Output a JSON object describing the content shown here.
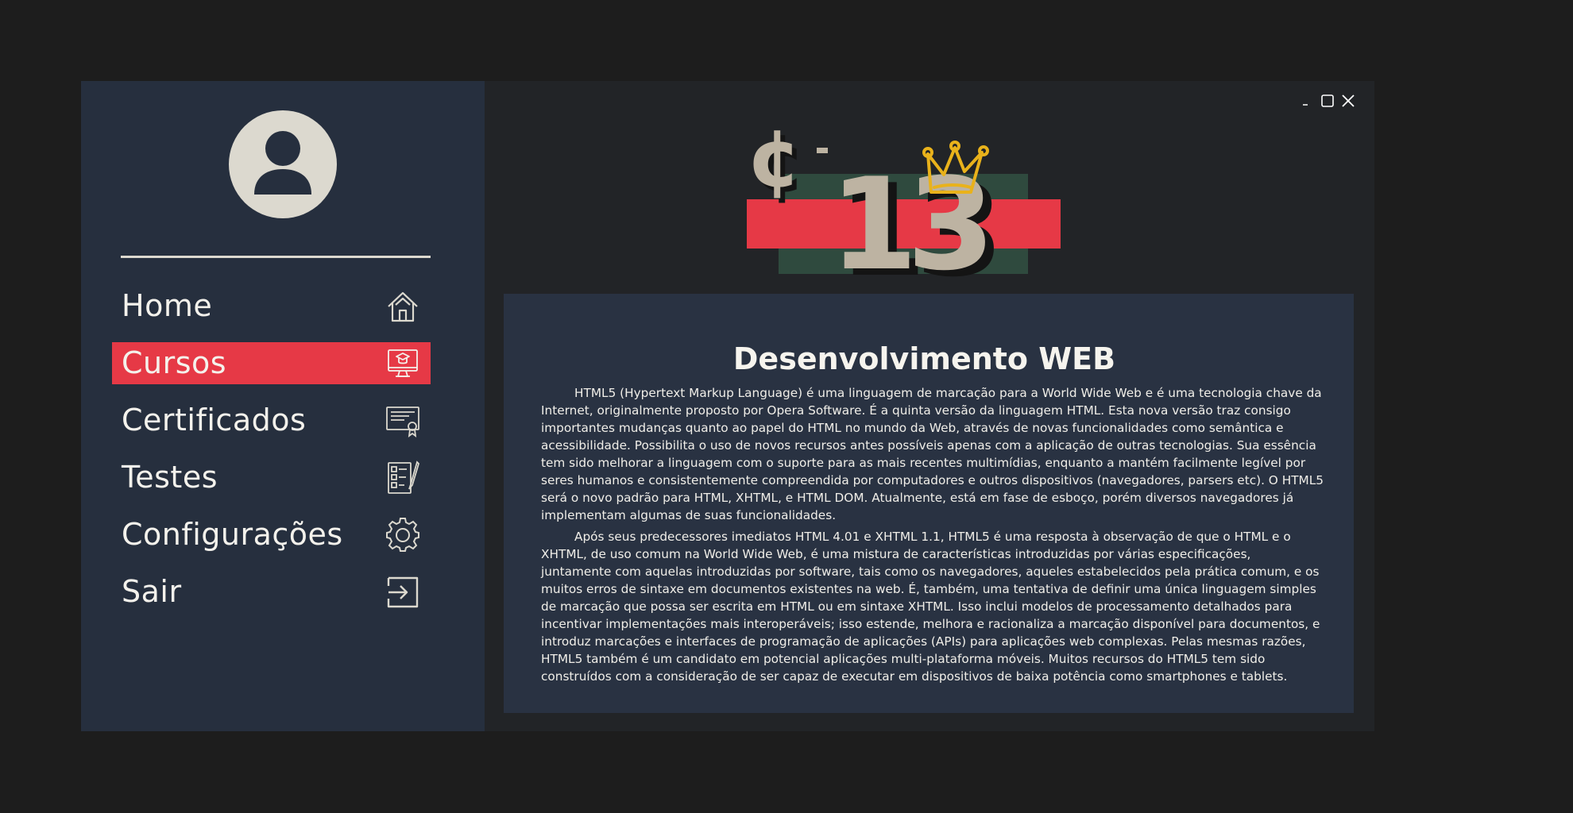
{
  "colors": {
    "background": "#1d1d1d",
    "sidebar": "#262f3e",
    "main": "#222427",
    "card": "#293242",
    "accent_red": "#e63946",
    "cream": "#dcd9cf",
    "green": "#2f4a3e",
    "gold": "#e9b21b"
  },
  "sidebar": {
    "avatar_icon": "user-icon",
    "items": [
      {
        "label": "Home",
        "icon": "home-icon",
        "active": false
      },
      {
        "label": "Cursos",
        "icon": "course-monitor-icon",
        "active": true
      },
      {
        "label": "Certificados",
        "icon": "certificate-icon",
        "active": false
      },
      {
        "label": "Testes",
        "icon": "checklist-icon",
        "active": false
      },
      {
        "label": "Configurações",
        "icon": "gear-icon",
        "active": false
      },
      {
        "label": "Sair",
        "icon": "logout-icon",
        "active": false
      }
    ]
  },
  "window_controls": {
    "minimize": "minimize-icon",
    "maximize": "maximize-icon",
    "close": "close-icon"
  },
  "logo": {
    "letter": "¢",
    "number": "13"
  },
  "content": {
    "title": "Desenvolvimento WEB",
    "paragraphs": [
      "HTML5 (Hypertext Markup Language) é uma linguagem de marcação para a World Wide Web e é uma tecnologia chave da Internet, originalmente proposto por Opera Software. É a quinta versão da linguagem HTML. Esta nova versão traz consigo importantes mudanças quanto ao papel do HTML no mundo da Web, através de novas funcionalidades como semântica e acessibilidade. Possibilita o uso de novos recursos antes possíveis apenas com a aplicação de outras tecnologias. Sua essência tem sido melhorar a linguagem com o suporte para as mais recentes multimídias, enquanto a mantém facilmente legível por seres humanos e consistentemente compreendida por computadores e outros dispositivos (navegadores, parsers etc). O HTML5 será o novo padrão para HTML, XHTML, e HTML DOM. Atualmente,  está em fase de esboço, porém diversos navegadores já implementam algumas de suas funcionalidades.",
      "Após seus predecessores imediatos HTML 4.01 e XHTML 1.1, HTML5 é uma resposta à observação de que o HTML e o XHTML, de uso comum na World Wide Web, é uma mistura de características introduzidas por várias especificações, juntamente com aquelas introduzidas por software, tais como os navegadores, aqueles estabelecidos pela prática comum, e os muitos erros de sintaxe em documentos existentes na web. É, também, uma tentativa de definir uma única linguagem simples de marcação que possa ser escrita em HTML ou em sintaxe XHTML. Isso inclui modelos de processamento detalhados para incentivar implementações mais interoperáveis; isso estende, melhora e racionaliza a marcação disponível para documentos, e introduz marcações e interfaces de programação de aplicações (APIs) para aplicações web complexas. Pelas mesmas razões, HTML5 também é um candidato em potencial aplicações multi-plataforma móveis. Muitos recursos do HTML5 tem sido construídos com a consideração de ser capaz de executar em dispositivos de baixa potência como smartphones e tablets."
    ]
  }
}
